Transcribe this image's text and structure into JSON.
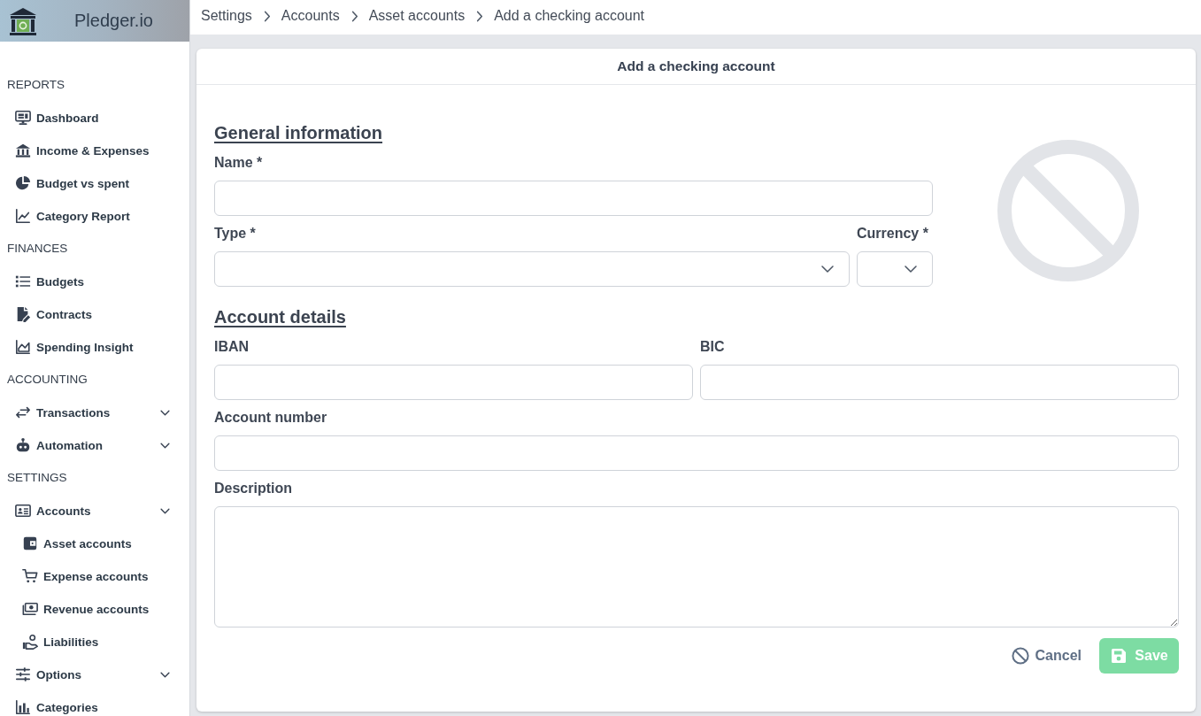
{
  "app": {
    "name": "Pledger.io"
  },
  "sidebar": {
    "sections": [
      {
        "title": "REPORTS",
        "items": [
          {
            "label": "Dashboard",
            "kind": "link"
          },
          {
            "label": "Income & Expenses",
            "kind": "link"
          },
          {
            "label": "Budget vs spent",
            "kind": "link"
          },
          {
            "label": "Category Report",
            "kind": "link"
          }
        ]
      },
      {
        "title": "FINANCES",
        "items": [
          {
            "label": "Budgets",
            "kind": "link"
          },
          {
            "label": "Contracts",
            "kind": "link"
          },
          {
            "label": "Spending Insight",
            "kind": "link"
          }
        ]
      },
      {
        "title": "ACCOUNTING",
        "items": [
          {
            "label": "Transactions",
            "kind": "group"
          },
          {
            "label": "Automation",
            "kind": "group"
          }
        ]
      },
      {
        "title": "SETTINGS",
        "items": [
          {
            "label": "Accounts",
            "kind": "group",
            "children": [
              {
                "label": "Asset accounts"
              },
              {
                "label": "Expense accounts"
              },
              {
                "label": "Revenue accounts"
              },
              {
                "label": "Liabilities"
              }
            ]
          },
          {
            "label": "Options",
            "kind": "group"
          },
          {
            "label": "Categories",
            "kind": "link"
          }
        ]
      }
    ]
  },
  "breadcrumb": [
    "Settings",
    "Accounts",
    "Asset accounts",
    "Add a checking account"
  ],
  "form": {
    "title": "Add a checking account",
    "sections": [
      {
        "heading": "General information",
        "rows": [
          [
            {
              "label": "Name *",
              "kind": "text"
            }
          ],
          [
            {
              "label": "Type *",
              "kind": "select"
            },
            {
              "label": "Currency *",
              "kind": "select"
            }
          ]
        ]
      },
      {
        "heading": "Account details",
        "rows": [
          [
            {
              "label": "IBAN",
              "kind": "text"
            },
            {
              "label": "BIC",
              "kind": "text"
            }
          ],
          [
            {
              "label": "Account number",
              "kind": "text"
            }
          ],
          [
            {
              "label": "Description",
              "kind": "textarea"
            }
          ]
        ]
      }
    ],
    "buttons": [
      {
        "label": "Cancel",
        "kind": "cancel"
      },
      {
        "label": "Save",
        "kind": "save",
        "disabled": true
      }
    ]
  }
}
